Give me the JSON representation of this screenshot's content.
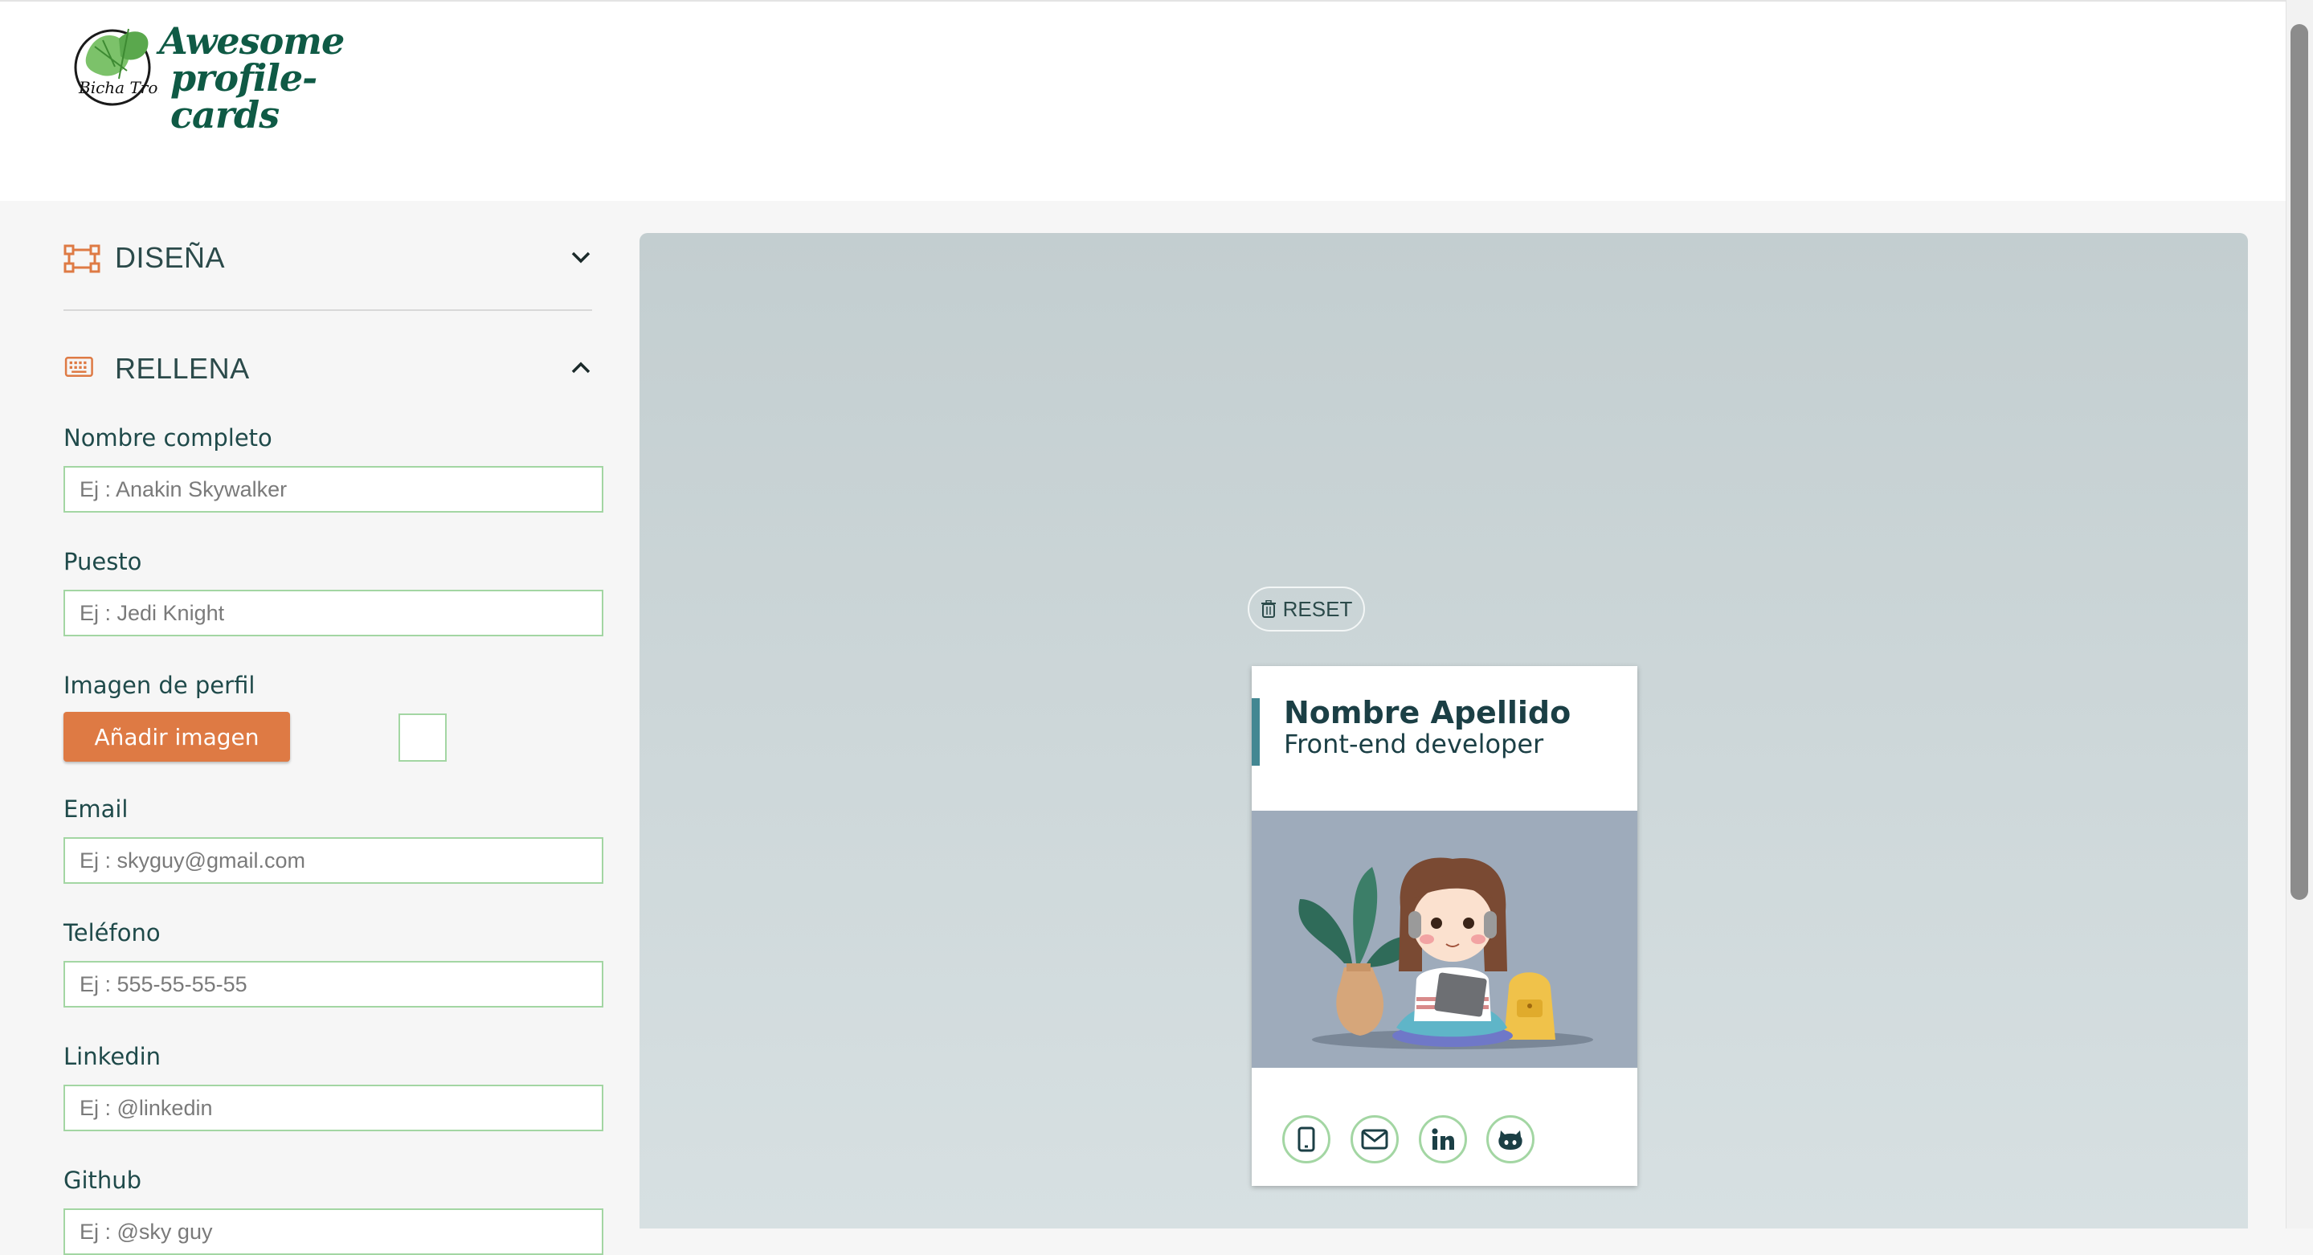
{
  "header": {
    "logo_line1": "Awesome",
    "logo_line2": "profile-cards",
    "logo_badge_text": "Bicha Tronica"
  },
  "sidebar": {
    "design_section": {
      "title": "DISEÑA",
      "icon": "palette-nodes-icon",
      "state": "collapsed"
    },
    "fill_section": {
      "title": "RELLENA",
      "icon": "keyboard-icon",
      "state": "expanded"
    }
  },
  "form": {
    "fullname": {
      "label": "Nombre completo",
      "placeholder": "Ej : Anakin Skywalker",
      "value": ""
    },
    "job": {
      "label": "Puesto",
      "placeholder": "Ej : Jedi Knight",
      "value": ""
    },
    "image": {
      "label": "Imagen de perfil",
      "button_label": "Añadir imagen"
    },
    "email": {
      "label": "Email",
      "placeholder": "Ej : skyguy@gmail.com",
      "value": ""
    },
    "phone": {
      "label": "Teléfono",
      "placeholder": "Ej : 555-55-55-55",
      "value": ""
    },
    "linkedin": {
      "label": "Linkedin",
      "placeholder": "Ej : @linkedin",
      "value": ""
    },
    "github": {
      "label": "Github",
      "placeholder": "Ej : @sky guy",
      "value": ""
    }
  },
  "preview": {
    "reset_label": "RESET",
    "card": {
      "name": "Nombre Apellido",
      "job": "Front-end developer",
      "social": [
        "phone-icon",
        "email-icon",
        "linkedin-icon",
        "github-icon"
      ]
    }
  },
  "colors": {
    "accent": "#de7a44",
    "brand_green": "#0f5a45",
    "input_border": "#a3d6a3",
    "card_bar": "#438792",
    "preview_bg": "#c3ced0"
  }
}
